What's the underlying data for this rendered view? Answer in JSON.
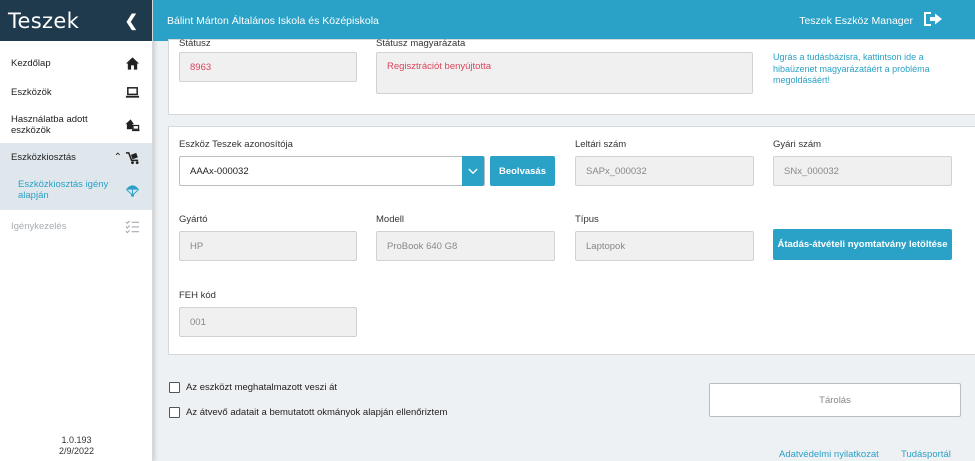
{
  "sidebar": {
    "brand": "Teszek",
    "items": [
      {
        "label": "Kezdőlap",
        "icon": "home-icon"
      },
      {
        "label": "Eszközök",
        "icon": "laptop-icon"
      },
      {
        "label": "Használatba adott eszközök",
        "icon": "device-handout-icon"
      },
      {
        "label": "Eszközkiosztás",
        "icon": "distribution-icon",
        "expanded": true
      },
      {
        "label": "Eszközkiosztás igény alapján",
        "icon": "parachute-icon"
      },
      {
        "label": "Igénykezelés",
        "icon": "checklist-icon",
        "disabled": true
      }
    ],
    "version": "1.0.193",
    "date": "2/9/2022"
  },
  "topbar": {
    "school": "Bálint Márton Általános Iskola és Középiskola",
    "app_name": "Teszek Eszköz Manager"
  },
  "status_card": {
    "status_label": "Státusz",
    "status_value": "8963",
    "status_reason_label": "Státusz magyarázata",
    "status_reason_value": "Regisztrációt benyújtotta",
    "kb_link": "Ugrás a tudásbázisra, kattintson ide a hibaüzenet magyarázatáért a probléma megoldásáért!"
  },
  "device_card": {
    "teszek_id_label": "Eszköz Teszek azonosítója",
    "teszek_id_value": "AAAx-000032",
    "scan_button": "Beolvasás",
    "inventory_label": "Leltári szám",
    "inventory_value": "SAPx_000032",
    "serial_label": "Gyári szám",
    "serial_value": "SNx_000032",
    "manufacturer_label": "Gyártó",
    "manufacturer_value": "HP",
    "model_label": "Modell",
    "model_value": "ProBook 640 G8",
    "type_label": "Típus",
    "type_value": "Laptopok",
    "download_button": "Átadás-átvételi nyomtatvány letöltése",
    "feh_label": "FEH kód",
    "feh_value": "001"
  },
  "checks": {
    "authorized": "Az eszközt meghatalmazott veszi át",
    "verified": "Az átvevő adatait a bemutatott okmányok alapján ellenőriztem"
  },
  "save_button": "Tárolás",
  "footer": {
    "privacy": "Adatvédelmi nyilatkozat",
    "portal": "Tudásportál"
  },
  "colors": {
    "accent": "#2aa1c6",
    "brand_bg": "#1f3a4d",
    "error_text": "#d9455b"
  }
}
